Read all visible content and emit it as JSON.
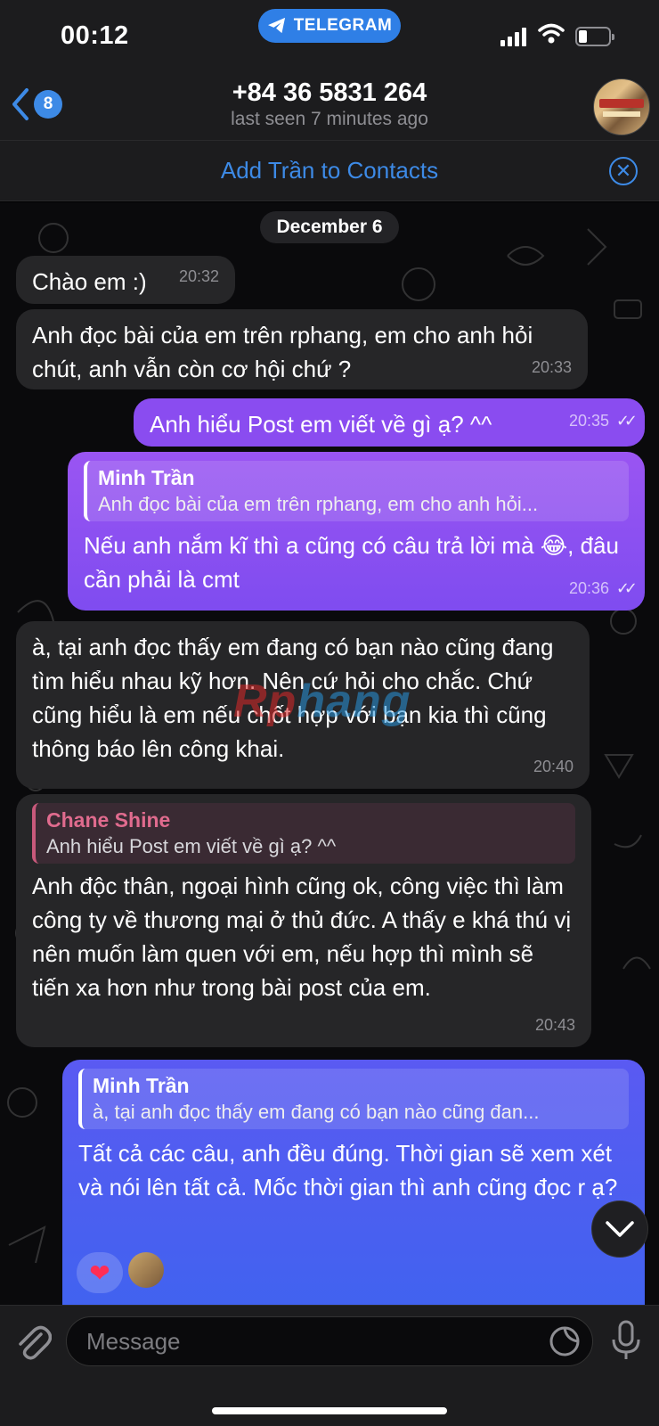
{
  "status_bar": {
    "time": "00:12",
    "source_label": "TELEGRAM"
  },
  "header": {
    "back_count": "8",
    "title": "+84 36 5831 264",
    "subtitle": "last seen 7 minutes ago"
  },
  "contact_bar": {
    "label": "Add Trần to Contacts"
  },
  "chat": {
    "date_label": "December 6",
    "watermark_a": "Rp",
    "watermark_b": "hang",
    "messages": [
      {
        "direction": "in",
        "text": "Chào em :)",
        "time": "20:32"
      },
      {
        "direction": "in",
        "text": "Anh đọc bài của em trên rphang, em cho anh hỏi chút, anh vẫn còn cơ hội chứ ?",
        "time": "20:33"
      },
      {
        "direction": "out",
        "text": "Anh hiểu Post em viết về gì ạ? ^^",
        "time": "20:35"
      },
      {
        "direction": "out",
        "reply_name": "Minh Trần",
        "reply_text": "Anh đọc bài của em trên rphang, em cho anh hỏi...",
        "text": "Nếu anh nắm kĩ thì a cũng có câu trả lời mà 😂, đâu cần phải là cmt",
        "time": "20:36"
      },
      {
        "direction": "in",
        "text": "à, tại anh đọc thấy em đang có bạn nào cũng đang tìm hiểu nhau kỹ hơn. Nên cứ hỏi cho chắc. Chứ cũng hiểu là em nếu chốt hợp với bạn kia thì cũng thông báo lên công khai.",
        "time": "20:40"
      },
      {
        "direction": "in",
        "reply_name": "Chane Shine",
        "reply_text": "Anh hiểu Post em viết về gì ạ? ^^",
        "text": "Anh độc thân, ngoại hình cũng ok, công việc thì làm công ty về thương mại ở thủ đức. A thấy e khá thú vị nên muốn làm quen với em, nếu hợp thì mình sẽ tiến xa hơn như trong bài post của em.",
        "time": "20:43"
      },
      {
        "direction": "out",
        "reply_name": "Minh Trần",
        "reply_text": "à, tại anh đọc thấy em đang có bạn nào cũng đan...",
        "text": "Tất cả các câu, anh đều đúng. Thời gian sẽ xem xét và nói lên tất cả. Mốc thời gian thì anh cũng đọc r ạ?"
      }
    ],
    "reaction": "❤"
  },
  "composer": {
    "placeholder": "Message"
  },
  "colors": {
    "accent": "#3d8ae6",
    "incoming_bubble": "#262628",
    "outgoing_purple": "#8a4cf0",
    "outgoing_blue": "#4a5ff0",
    "reply_name_in": "#e06b8e"
  }
}
